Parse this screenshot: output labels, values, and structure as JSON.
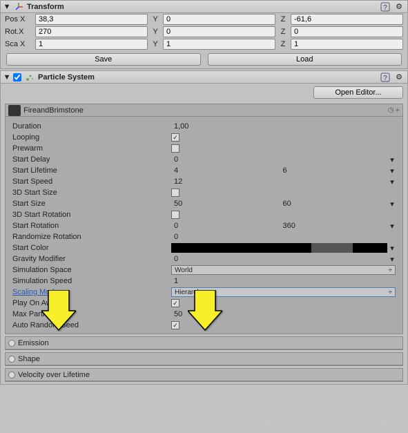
{
  "transform": {
    "title": "Transform",
    "pos": {
      "x_label": "Pos X",
      "y_label": "Y",
      "z_label": "Z",
      "x": "38,3",
      "y": "0",
      "z": "-61,6"
    },
    "rot": {
      "x_label": "Rot.X",
      "y_label": "Y",
      "z_label": "Z",
      "x": "270",
      "y": "0",
      "z": "0"
    },
    "sca": {
      "x_label": "Sca X",
      "y_label": "Y",
      "z_label": "Z",
      "x": "1",
      "y": "1",
      "z": "1"
    },
    "save_btn": "Save",
    "load_btn": "Load"
  },
  "particle_system": {
    "title": "Particle System",
    "open_editor_btn": "Open Editor...",
    "name": "FireandBrimstone",
    "props": {
      "duration": {
        "label": "Duration",
        "value": "1,00"
      },
      "looping": {
        "label": "Looping",
        "checked": true
      },
      "prewarm": {
        "label": "Prewarm",
        "checked": false
      },
      "start_delay": {
        "label": "Start Delay",
        "value": "0"
      },
      "start_lifetime": {
        "label": "Start Lifetime",
        "a": "4",
        "b": "6"
      },
      "start_speed": {
        "label": "Start Speed",
        "value": "12"
      },
      "3d_start_size": {
        "label": "3D Start Size",
        "checked": false
      },
      "start_size": {
        "label": "Start Size",
        "a": "50",
        "b": "60"
      },
      "3d_start_rotation": {
        "label": "3D Start Rotation",
        "checked": false
      },
      "start_rotation": {
        "label": "Start Rotation",
        "a": "0",
        "b": "360"
      },
      "randomize_rotation": {
        "label": "Randomize Rotation",
        "value": "0"
      },
      "start_color": {
        "label": "Start Color"
      },
      "gravity_modifier": {
        "label": "Gravity Modifier",
        "value": "0"
      },
      "simulation_space": {
        "label": "Simulation Space",
        "value": "World"
      },
      "simulation_speed": {
        "label": "Simulation Speed",
        "value": "1"
      },
      "scaling_mode": {
        "label": "Scaling Mode",
        "value": "Hierarchy"
      },
      "play_on_awake": {
        "label": "Play On Awake*",
        "checked": true
      },
      "max_particles": {
        "label": "Max Particles",
        "value": "50"
      },
      "auto_random_seed": {
        "label": "Auto Random Seed",
        "checked": true
      }
    },
    "modules": {
      "emission": "Emission",
      "shape": "Shape",
      "velocity_over_lifetime": "Velocity over Lifetime"
    }
  },
  "glyphs": {
    "check": "✓",
    "down": "▾",
    "tri_down": "▼",
    "updown": "⇅",
    "plus": "+",
    "clock": "◷",
    "help": "?",
    "gear": "⚙"
  },
  "watermark": "https://blog.csdn.net/qq_41452267"
}
